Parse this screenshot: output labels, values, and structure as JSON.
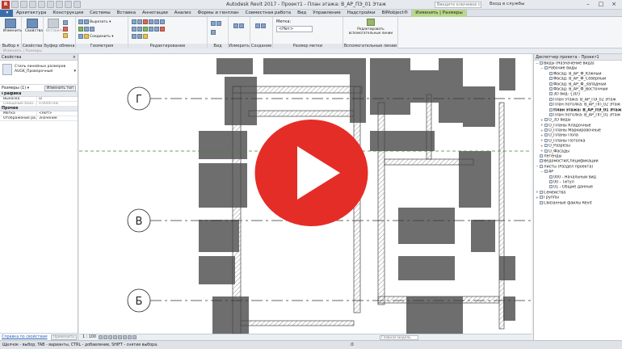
{
  "titlebar": {
    "title": "Autodesk Revit 2017 -   Проект1 - План этажа: В_АР_ПЭ_01 Этаж",
    "search_placeholder": "Введите ключевое слово/фразу",
    "login": "Вход в службы",
    "logo": "R"
  },
  "tabs": [
    "Архитектура",
    "Конструкция",
    "Системы",
    "Вставка",
    "Аннотации",
    "Анализ",
    "Формы и генплан",
    "Совместная работа",
    "Вид",
    "Управление",
    "Надстройки",
    "BIMobject®",
    "Изменить | Размеры"
  ],
  "ribbon": {
    "modify": "Изменить",
    "select_panel": "Выбор ▾",
    "properties_btn": "Свойства",
    "properties_panel": "Свойства",
    "paste": "Вставить",
    "clipboard_panel": "Буфер обмена",
    "cut": "Вырезать ▾",
    "join": "Соединить ▾",
    "geometry_panel": "Геометрия",
    "modify_panel": "Редактирование",
    "view_panel": "Вид",
    "measure_panel": "Измерить",
    "create_panel": "Создание",
    "labels_caption": "Метка:",
    "labels_value": "<Нет>",
    "dim_panel": "Размер метки",
    "ref_line": "Редактировать вспомогательные линии",
    "ref_panel": "Вспомогательные линии"
  },
  "optbar": "Изменить | Размеры",
  "props": {
    "header": "Свойства",
    "type_name": "Стиль линейных размеров AUGK_Проверочный",
    "selector": "Размеры (1)",
    "edit_type": "Изменить тип",
    "cat_graphics": "Графика",
    "rows_graphics": [
      {
        "k": "Выноска",
        "v": "☑"
      },
      {
        "k": "Смещение базо...",
        "v": "0.0000 мм"
      }
    ],
    "cat_other": "Прочее",
    "rows_other": [
      {
        "k": "Метка",
        "v": "<Нет>"
      },
      {
        "k": "Отображение ра...",
        "v": "Значение"
      }
    ],
    "help_link": "Справка по свойствам",
    "apply": "Применить"
  },
  "canvas": {
    "grid_labels": [
      "Г",
      "В",
      "Б"
    ]
  },
  "browser": {
    "header": "Диспетчер проекта - Проект1",
    "nodes": [
      {
        "t": "−",
        "label": "Виды (Назначение вида)",
        "indent": 0
      },
      {
        "t": "−",
        "label": "Рабочие виды",
        "indent": 1
      },
      {
        "t": "",
        "label": "Фасад: В_АР_Ф_Южный",
        "indent": 2
      },
      {
        "t": "",
        "label": "Фасад: В_АР_Ф_Северный",
        "indent": 2
      },
      {
        "t": "",
        "label": "Фасад: В_АР_Ф_Западный",
        "indent": 2
      },
      {
        "t": "",
        "label": "Фасад: В_АР_Ф_Восточный",
        "indent": 2
      },
      {
        "t": "",
        "label": "3D вид: {3D}",
        "indent": 2
      },
      {
        "t": "",
        "label": "План этажа: В_АР_ПЭ_02 Этаж",
        "indent": 2
      },
      {
        "t": "",
        "label": "План потолка: В_АР_ПП_02 Этаж",
        "indent": 2
      },
      {
        "t": "",
        "label": "План этажа: В_АР_ПЭ_01 Этаж",
        "indent": 2,
        "bold": true
      },
      {
        "t": "",
        "label": "План потолка: В_АР_ПП_01 Этаж",
        "indent": 2
      },
      {
        "t": "+",
        "label": "О_3D виды",
        "indent": 1
      },
      {
        "t": "+",
        "label": "О_Планы Кладочные",
        "indent": 1
      },
      {
        "t": "+",
        "label": "О_Планы Маркировочные",
        "indent": 1
      },
      {
        "t": "+",
        "label": "О_Планы Пола",
        "indent": 1
      },
      {
        "t": "+",
        "label": "О_Планы Потолка",
        "indent": 1
      },
      {
        "t": "+",
        "label": "О_Разрезы",
        "indent": 1
      },
      {
        "t": "+",
        "label": "О_Фасады",
        "indent": 1
      },
      {
        "t": "",
        "label": "Легенды",
        "indent": 0
      },
      {
        "t": "",
        "label": "Ведомости/Спецификации",
        "indent": 0
      },
      {
        "t": "−",
        "label": "Листы (Раздел проекта)",
        "indent": 0
      },
      {
        "t": "−",
        "label": "АР",
        "indent": 1
      },
      {
        "t": "",
        "label": "000 - Начальный вид",
        "indent": 2
      },
      {
        "t": "",
        "label": "00 - Титул",
        "indent": 2
      },
      {
        "t": "",
        "label": "01 - Общие данные",
        "indent": 2
      },
      {
        "t": "+",
        "label": "Семейства",
        "indent": 0
      },
      {
        "t": "+",
        "label": "Группы",
        "indent": 0
      },
      {
        "t": "",
        "label": "Связанные файлы Revit",
        "indent": 0
      }
    ]
  },
  "viewctrl": {
    "scale": "1 : 100",
    "model": "Главная модель"
  },
  "status": {
    "hint": "Щелчок - выбор, TAB - варианты, CTRL - добавление, SHIFT - снятие выбора.",
    "zero": ":0"
  },
  "colors": {
    "play": "#e52d27",
    "wall": "#6e6e6e"
  }
}
